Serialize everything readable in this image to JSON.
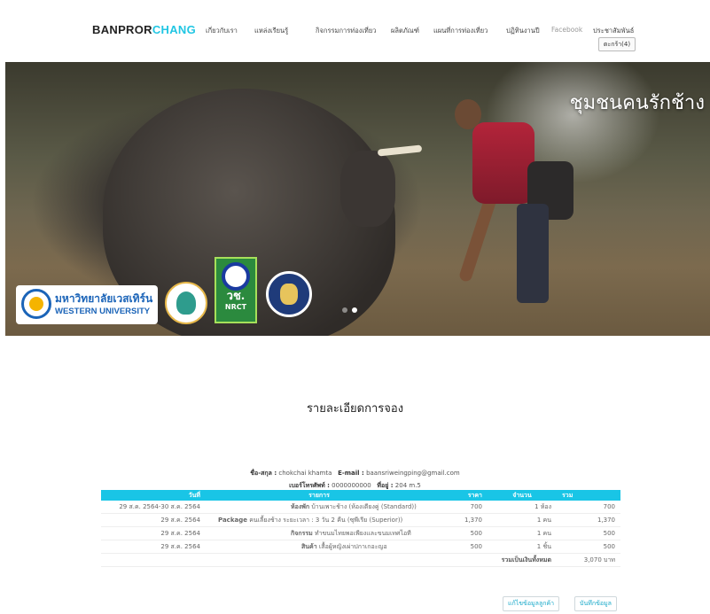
{
  "brand": {
    "part1": "BANPROR",
    "part2": "CHANG",
    "accent": "#21c6e3"
  },
  "nav": {
    "items": [
      "เกี่ยวกับเรา",
      "แหล่งเรียนรู้",
      "กิจกรรมการท่องเที่ยว",
      "ผลิตภัณฑ์",
      "แผนที่การท่องเที่ยว",
      "ปฏิทินงานปี",
      "Facebook",
      "ประชาสัมพันธ์"
    ],
    "cart_label": "ตะกร้า(4)"
  },
  "hero": {
    "title": "ชุมชนคนรักช้าง",
    "logos": {
      "wu_thai": "มหาวิทยาลัยเวสเทิร์น",
      "wu_en": "WESTERN UNIVERSITY",
      "nrct_thai": "วช.",
      "nrct_en": "NRCT"
    },
    "slides": 2,
    "active_slide": 1
  },
  "booking": {
    "title": "รายละเอียดการจอง",
    "name_label": "ชื่อ-สกุล :",
    "name": "chokchai khamta",
    "email_label": "E-mail :",
    "email": "baansriweingping@gmail.com",
    "phone_label": "เบอร์โทรศัพท์ :",
    "phone": "0000000000",
    "address_label": "ที่อยู่ :",
    "address": "204 m.5",
    "columns": [
      "วันที่",
      "รายการ",
      "ราคา",
      "จำนวน",
      "รวม"
    ],
    "rows": [
      {
        "date": "29 ส.ค. 2564-30 ส.ค. 2564",
        "type": "ห้องพัก",
        "desc": "บ้านเพาะช้าง (ห้องเตียงคู่ (Standard))",
        "price": "700",
        "qty": "1 ห้อง",
        "total": "700"
      },
      {
        "date": "29 ส.ค. 2564",
        "type": "Package",
        "desc": "คนเลี้ยงช้าง ระยะเวลา : 3 วัน 2 คืน (ซุพีเรีย (Superior))",
        "price": "1,370",
        "qty": "1 คน",
        "total": "1,370"
      },
      {
        "date": "29 ส.ค. 2564",
        "type": "กิจกรรม",
        "desc": "ทำขนมไทยพอเพียงและขนมเทศไอที",
        "price": "500",
        "qty": "1 คน",
        "total": "500"
      },
      {
        "date": "29 ส.ค. 2564",
        "type": "สินค้า",
        "desc": "เสื้อผู้หญิงเผ่าปกาเกอะญอ",
        "price": "500",
        "qty": "1 ชิ้น",
        "total": "500"
      }
    ],
    "grand_total_label": "รวมเป็นเงินทั้งหมด",
    "grand_total": "3,070 บาท",
    "edit_button": "แก้ไขข้อมูลลูกค้า",
    "save_button": "บันทึกข้อมูล"
  }
}
